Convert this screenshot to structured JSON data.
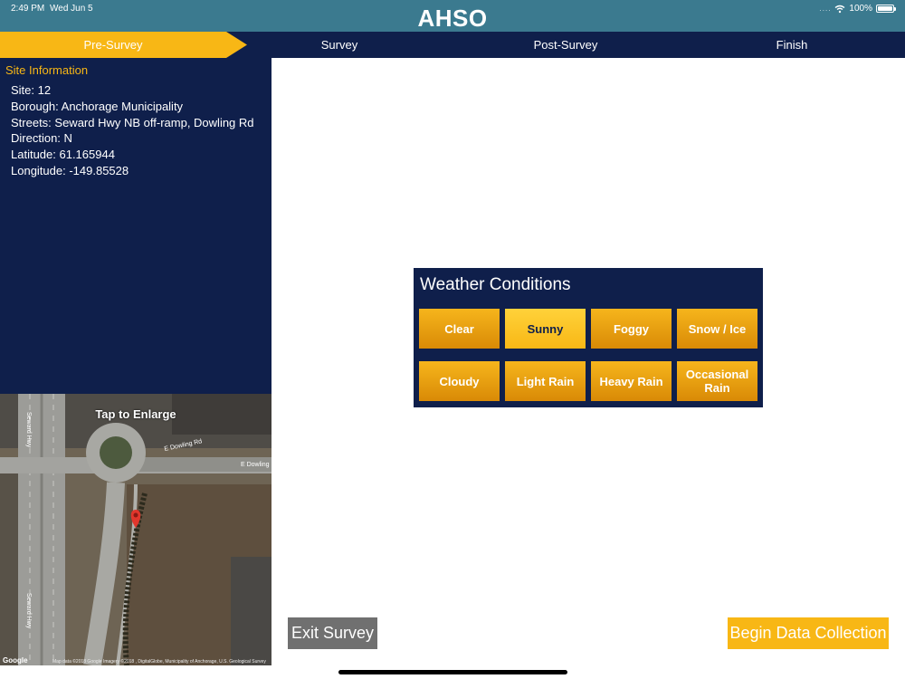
{
  "status": {
    "time": "2:49 PM",
    "date": "Wed Jun 5",
    "battery": "100%",
    "signal": "...."
  },
  "app": {
    "title": "AHSO"
  },
  "steps": [
    "Pre-Survey",
    "Survey",
    "Post-Survey",
    "Finish"
  ],
  "active_step": "Pre-Survey",
  "site": {
    "heading": "Site Information",
    "lines": [
      "Site: 12",
      "Borough: Anchorage Municipality",
      "Streets: Seward Hwy NB off-ramp, Dowling Rd",
      "Direction: N",
      "Latitude: 61.165944",
      "Longitude: -149.85528"
    ]
  },
  "map": {
    "enlarge_label": "Tap to Enlarge",
    "google": "Google",
    "attribution": "Map data ©2018 Google  Imagery ©2018 , DigitalGlobe, Municipality of Anchorage, U.S. Geological Survey",
    "road_labels": [
      "E Dowling Rd",
      "E Dowling Rd",
      "Seward Hwy",
      "Seward Hwy"
    ]
  },
  "weather": {
    "title": "Weather Conditions",
    "options": [
      "Clear",
      "Sunny",
      "Foggy",
      "Snow / Ice",
      "Cloudy",
      "Light Rain",
      "Heavy Rain",
      "Occasional Rain"
    ],
    "selected": "Sunny"
  },
  "buttons": {
    "exit": "Exit Survey",
    "begin": "Begin Data Collection"
  },
  "colors": {
    "header": "#3b7a8f",
    "navy": "#0f1f4b",
    "accent": "#f8b715",
    "exit_gray": "#707070"
  }
}
